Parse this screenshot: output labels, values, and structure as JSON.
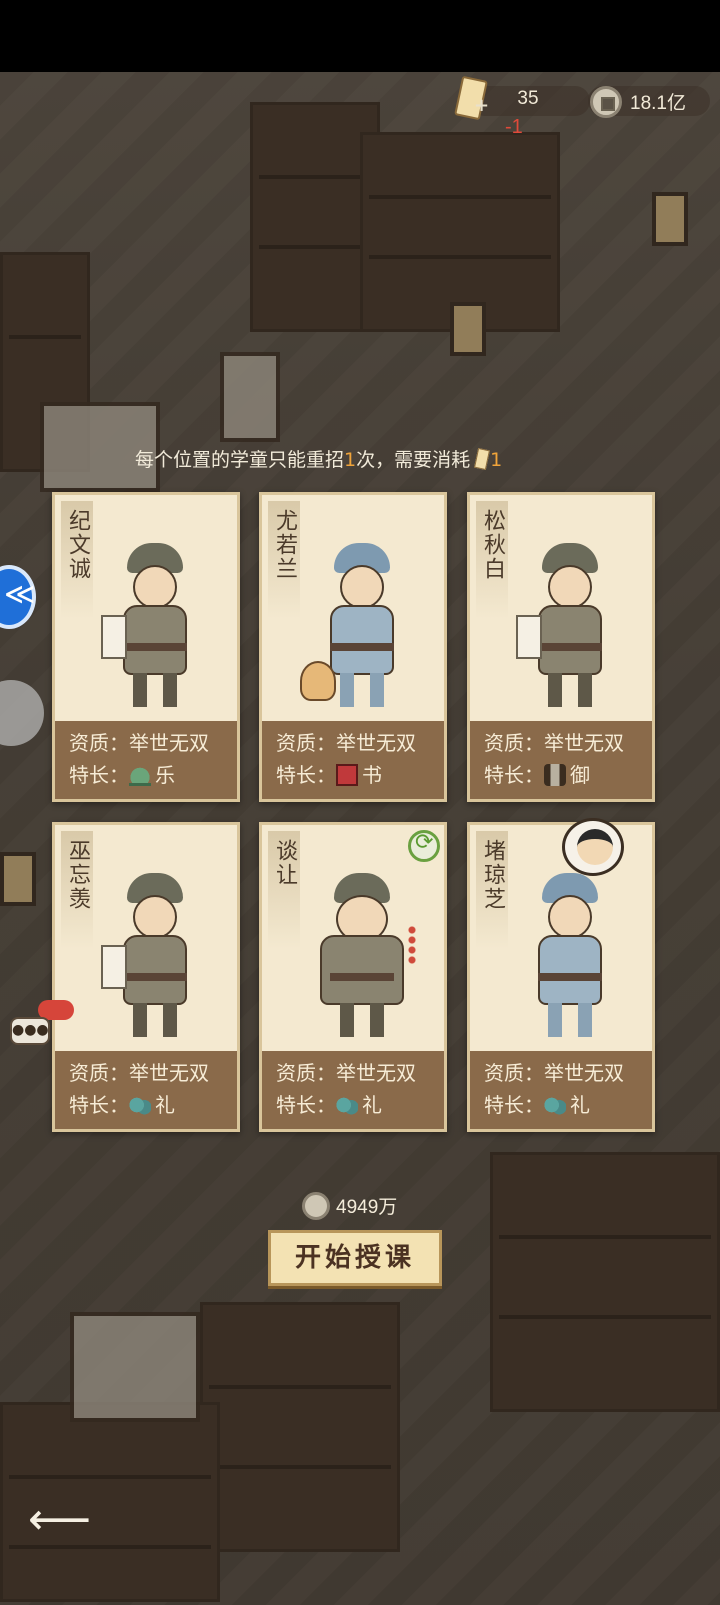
{
  "resources": {
    "tickets": "35",
    "ticket_change": "-1",
    "coins": "18.1亿"
  },
  "notice": {
    "prefix": "每个位置的学童只能重招",
    "count": "1",
    "middle": "次，需要消耗",
    "cost": "1"
  },
  "cards": [
    {
      "name": "纪文诚",
      "quality_label": "资质：",
      "quality": "举世无双",
      "skill_label": "特长：",
      "skill": "乐",
      "skill_icon": "bell-icon"
    },
    {
      "name": "尤若兰",
      "quality_label": "资质：",
      "quality": "举世无双",
      "skill_label": "特长：",
      "skill": "书",
      "skill_icon": "book-icon"
    },
    {
      "name": "松秋白",
      "quality_label": "资质：",
      "quality": "举世无双",
      "skill_label": "特长：",
      "skill": "御",
      "skill_icon": "reins-icon"
    },
    {
      "name": "巫忘羡",
      "quality_label": "资质：",
      "quality": "举世无双",
      "skill_label": "特长：",
      "skill": "礼",
      "skill_icon": "ritual-vessel-icon"
    },
    {
      "name": "谈让",
      "quality_label": "资质：",
      "quality": "举世无双",
      "skill_label": "特长：",
      "skill": "礼",
      "skill_icon": "ritual-vessel-icon"
    },
    {
      "name": "堵琼芝",
      "quality_label": "资质：",
      "quality": "举世无双",
      "skill_label": "特长：",
      "skill": "礼",
      "skill_icon": "ritual-vessel-icon"
    }
  ],
  "footer": {
    "cost": "4949万",
    "start_button": "开始授课"
  },
  "colors": {
    "card_bg": "#f4e9d0",
    "info_bg": "#8a6a4a",
    "highlight": "#f0a43a",
    "ticket_minus": "#e04a3a"
  }
}
